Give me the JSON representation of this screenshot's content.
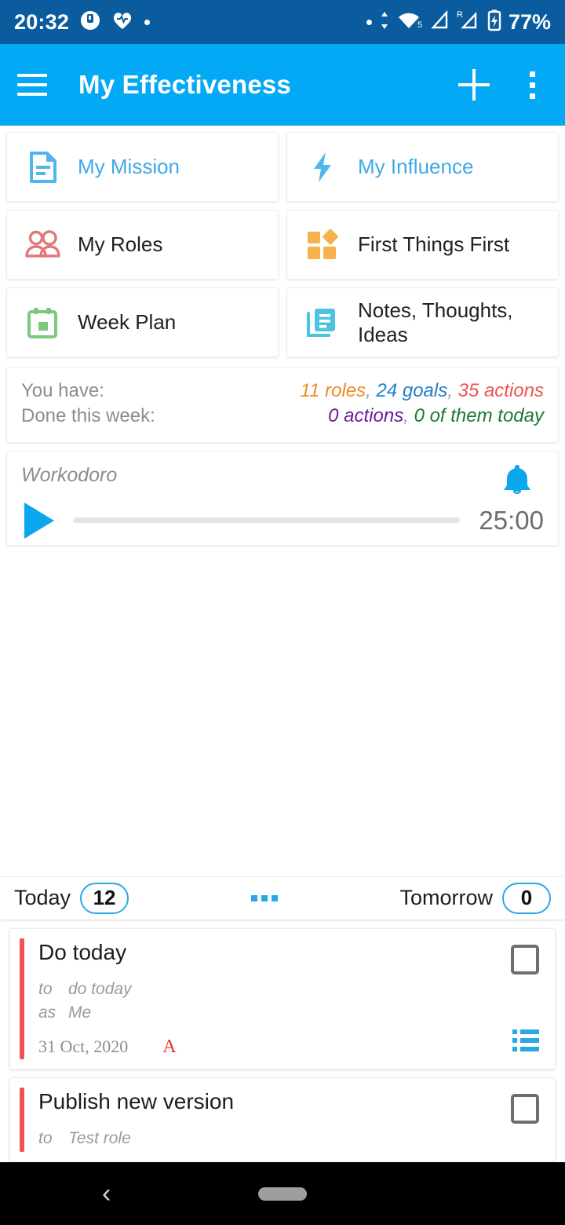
{
  "status_bar": {
    "time": "20:32",
    "battery_text": "77%",
    "left_icons": [
      "app-circle-icon",
      "heart-icon",
      "dot-icon"
    ],
    "right_icons": [
      "dot-icon",
      "data-transfer-icon",
      "wifi-5-icon",
      "signal-icon",
      "roaming-signal-icon",
      "battery-charging-icon"
    ],
    "bg_color": "#0b5c9e"
  },
  "app_bar": {
    "title": "My Effectiveness",
    "menu_icon": "hamburger-icon",
    "add_icon": "plus-icon",
    "overflow_icon": "kebab-icon",
    "bg_color": "#03a9f4"
  },
  "grid": {
    "items": [
      {
        "label": "My Mission",
        "icon": "document-icon",
        "color": "#3fa9e8",
        "label_blue": true
      },
      {
        "label": "My Influence",
        "icon": "lightning-icon",
        "color": "#3fa9e8",
        "label_blue": true
      },
      {
        "label": "My Roles",
        "icon": "people-icon",
        "color": "#e07a7a",
        "label_blue": false
      },
      {
        "label": "First Things First",
        "icon": "quadrant-icon",
        "color": "#f7b24d",
        "label_blue": false
      },
      {
        "label": "Week Plan",
        "icon": "calendar-icon",
        "color": "#7ec77e",
        "label_blue": false
      },
      {
        "label": "Notes, Thoughts, Ideas",
        "icon": "notes-icon",
        "color": "#4ec3e0",
        "label_blue": false
      }
    ]
  },
  "stats": {
    "have_label": "You have:",
    "done_label": "Done this week:",
    "roles": "11 roles",
    "goals": "24 goals",
    "actions": "35 actions",
    "done_actions": "0 actions",
    "done_today": "0 of them today",
    "comma": ", ",
    "colors": {
      "roles": "#f08a24",
      "goals": "#1e7fc4",
      "actions": "#ef5350",
      "done_actions": "#6a1b9a",
      "done_today": "#1b7a2e"
    }
  },
  "pomodoro": {
    "title": "Workodoro",
    "time": "25:00",
    "play_icon": "play-icon",
    "bell_icon": "bell-icon",
    "progress_percent": 0
  },
  "day_bar": {
    "today_label": "Today",
    "today_count": "12",
    "tomorrow_label": "Tomorrow",
    "tomorrow_count": "0",
    "more_icon": "three-dots-icon"
  },
  "tasks": [
    {
      "title": "Do today",
      "to_key": "to",
      "to_value": "do today",
      "as_key": "as",
      "as_value": "Me",
      "date": "31 Oct, 2020",
      "flag": "A",
      "checkbox_icon": "checkbox-empty-icon",
      "list_icon": "list-icon",
      "stripe_color": "#ef5350"
    },
    {
      "title": "Publish new version",
      "to_key": "to",
      "to_value": "Test role",
      "checkbox_icon": "checkbox-empty-icon",
      "stripe_color": "#ef5350"
    }
  ],
  "nav_bar": {
    "back_icon": "back-chevron-icon",
    "home_icon": "home-pill-icon"
  }
}
